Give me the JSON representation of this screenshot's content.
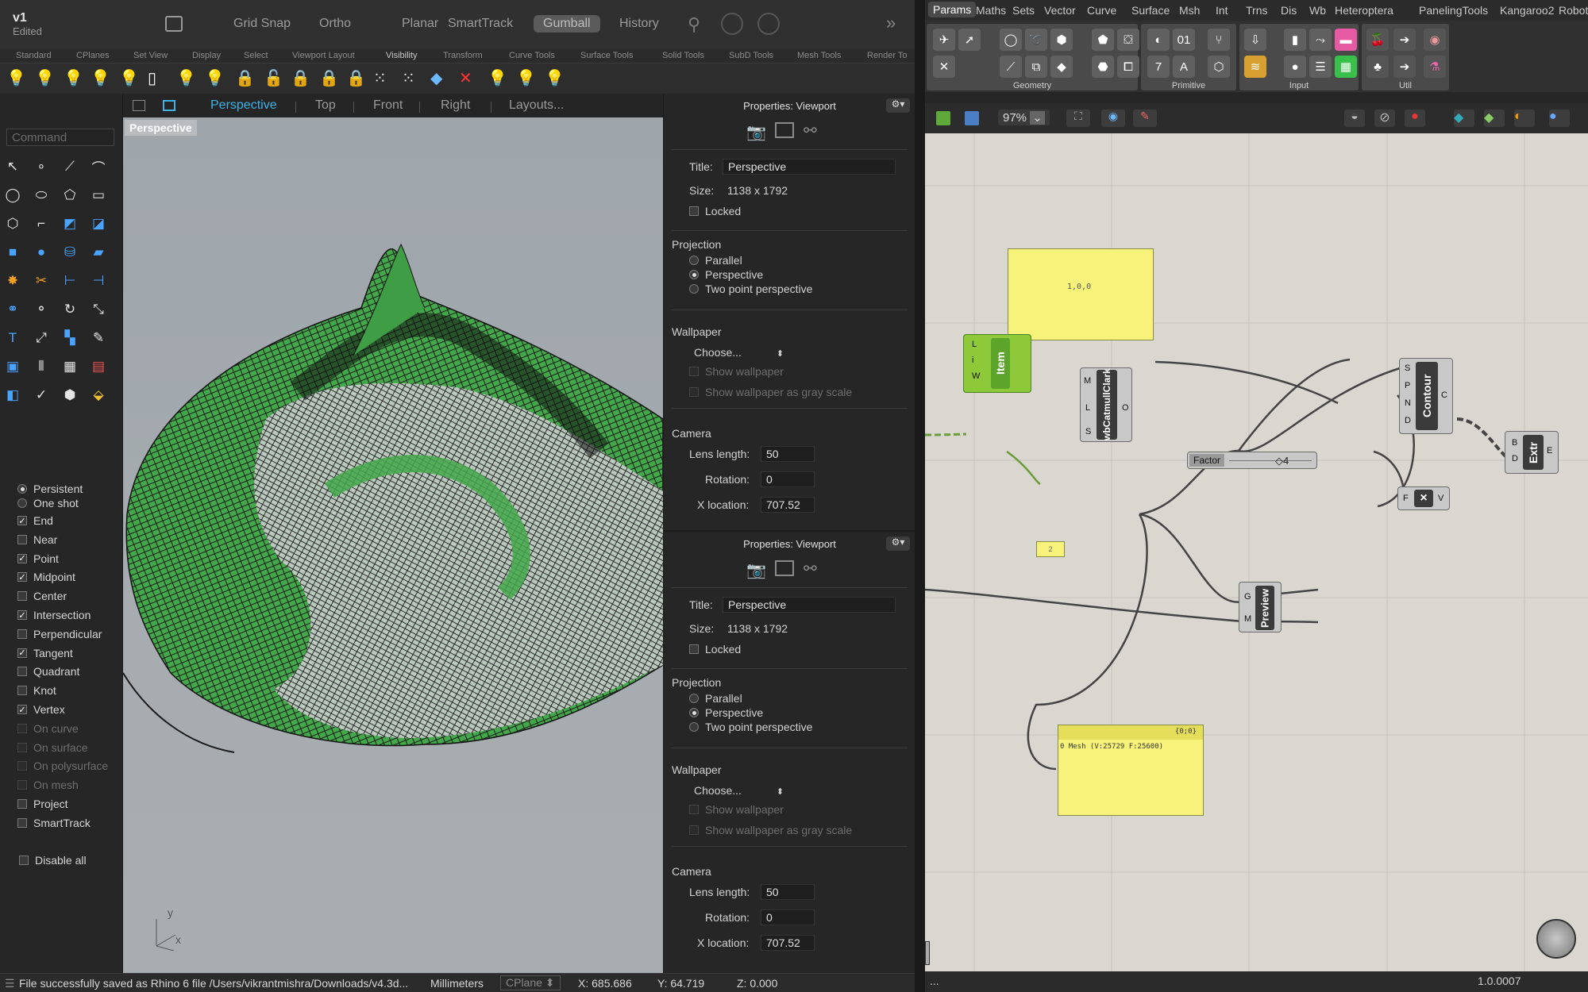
{
  "rhino": {
    "doc_name": "v1",
    "doc_status": "Edited",
    "toolbar": [
      "Grid Snap",
      "Ortho",
      "Planar",
      "SmartTrack",
      "Gumball",
      "History"
    ],
    "tabs": [
      "Standard",
      "CPlanes",
      "Set View",
      "Display",
      "Select",
      "Viewport Layout",
      "Visibility",
      "Transform",
      "Curve Tools",
      "Surface Tools",
      "Solid Tools",
      "SubD Tools",
      "Mesh Tools",
      "Render To"
    ],
    "viewport_tabs": [
      "Perspective",
      "Top",
      "Front",
      "Right",
      "Layouts..."
    ],
    "viewport_label": "Perspective",
    "command_placeholder": "Command",
    "osnap_mode": [
      "Persistent",
      "One shot"
    ],
    "osnaps": [
      {
        "label": "End",
        "checked": true
      },
      {
        "label": "Near",
        "checked": false
      },
      {
        "label": "Point",
        "checked": true
      },
      {
        "label": "Midpoint",
        "checked": true
      },
      {
        "label": "Center",
        "checked": false
      },
      {
        "label": "Intersection",
        "checked": true
      },
      {
        "label": "Perpendicular",
        "checked": false
      },
      {
        "label": "Tangent",
        "checked": true
      },
      {
        "label": "Quadrant",
        "checked": false
      },
      {
        "label": "Knot",
        "checked": false
      },
      {
        "label": "Vertex",
        "checked": true
      },
      {
        "label": "On curve",
        "checked": false
      },
      {
        "label": "On surface",
        "checked": false
      },
      {
        "label": "On polysurface",
        "checked": false
      },
      {
        "label": "On mesh",
        "checked": false
      },
      {
        "label": "Project",
        "checked": false
      },
      {
        "label": "SmartTrack",
        "checked": false
      }
    ],
    "disable_all": "Disable all",
    "props": {
      "header": "Properties: Viewport",
      "title_label": "Title:",
      "title_value": "Perspective",
      "size_label": "Size:",
      "size_value": "1138 x 1792",
      "locked": "Locked",
      "projection": "Projection",
      "proj_opts": [
        "Parallel",
        "Perspective",
        "Two point perspective"
      ],
      "wallpaper": "Wallpaper",
      "choose": "Choose...",
      "show_wp": "Show wallpaper",
      "show_wp_gray": "Show wallpaper as gray scale",
      "camera": "Camera",
      "lens_label": "Lens length:",
      "lens_value": "50",
      "rot_label": "Rotation:",
      "rot_value": "0",
      "xloc_label": "X location:",
      "xloc_value": "707.52"
    },
    "status": {
      "message": "File successfully saved as Rhino 6 file /Users/vikrantmishra/Downloads/v4.3d...",
      "units": "Millimeters",
      "cplane": "CPlane",
      "x": "X: 685.686",
      "y": "Y: 64.719",
      "z": "Z: 0.000"
    },
    "axis_y": "y",
    "axis_x": "x"
  },
  "gh": {
    "tabs": [
      "Params",
      "Maths",
      "Sets",
      "Vector",
      "Curve",
      "Surface",
      "Msh",
      "Int",
      "Trns",
      "Dis",
      "Wb",
      "Heteroptera",
      "PanelingTools",
      "Kangaroo2",
      "Robots"
    ],
    "groups": [
      "Geometry",
      "Primitive",
      "Input",
      "Util"
    ],
    "zoom": "97%",
    "panel1": "1,0,0",
    "panel_small": "2",
    "panel2_header": "{0;0}",
    "panel2_line": "0 Mesh (V:25729  F:25600)",
    "item": "Item",
    "item_pins": [
      "L",
      "i",
      "W"
    ],
    "catmull": "wbCatmullClark",
    "catmull_in": [
      "M",
      "L",
      "S"
    ],
    "catmull_out": "O",
    "contour": "Contour",
    "contour_in": [
      "S",
      "P",
      "N",
      "D"
    ],
    "contour_out": "C",
    "extr": "Extr",
    "extr_in": [
      "B",
      "D"
    ],
    "extr_out": "E",
    "mult": "×",
    "mult_in": "F",
    "mult_out": "V",
    "preview": "Preview",
    "preview_in": [
      "G",
      "M"
    ],
    "slider_label": "Factor",
    "slider_value": "4",
    "status_left": "...",
    "version": "1.0.0007"
  }
}
